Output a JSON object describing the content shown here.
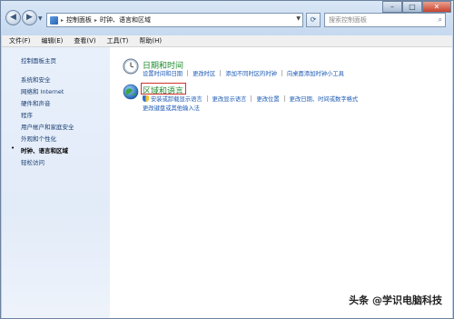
{
  "nav": {
    "back_icon": "back-arrow-icon",
    "forward_icon": "forward-arrow-icon",
    "breadcrumbs": [
      "控制面板",
      "时钟、语言和区域"
    ],
    "search_placeholder": "搜索控制面板",
    "refresh_icon": "refresh-icon"
  },
  "window_controls": {
    "minimize": "–",
    "maximize": "□",
    "close": "✕"
  },
  "menu": [
    "文件(F)",
    "编辑(E)",
    "查看(V)",
    "工具(T)",
    "帮助(H)"
  ],
  "sidebar": {
    "home": "控制面板主页",
    "items": [
      {
        "label": "系统和安全"
      },
      {
        "label": "网络和 Internet"
      },
      {
        "label": "硬件和声音"
      },
      {
        "label": "程序"
      },
      {
        "label": "用户帐户和家庭安全"
      },
      {
        "label": "外观和个性化"
      },
      {
        "label": "时钟、语言和区域",
        "active": true
      },
      {
        "label": "轻松访问"
      }
    ]
  },
  "categories": [
    {
      "title": "日期和时间",
      "icon": "clock-icon",
      "links": [
        "设置时间和日期",
        "更改时区",
        "添加不同时区的时钟",
        "向桌面添加时钟小工具"
      ]
    },
    {
      "title": "区域和语言",
      "icon": "globe-icon",
      "links_row1": [
        "安装或卸载显示语言",
        "更改显示语言",
        "更改位置",
        "更改日期、时间或数字格式"
      ],
      "links_row2": [
        "更改键盘或其他输入法"
      ]
    }
  ],
  "watermark": "头条 @学识电脑科技",
  "colors": {
    "category_title": "#1d8a2c",
    "link": "#1a59b5",
    "highlight": "#d0312d"
  }
}
